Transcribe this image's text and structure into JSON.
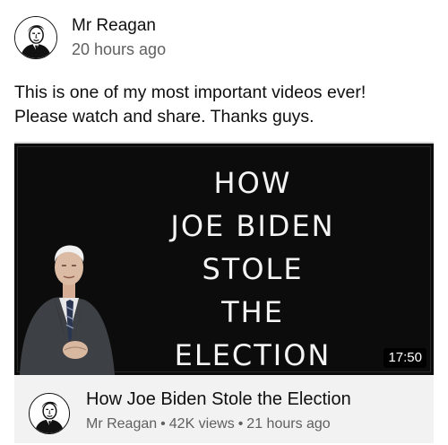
{
  "post": {
    "author": "Mr Reagan",
    "time": "20 hours ago",
    "text_lines": [
      "This is one of my most important videos ever!",
      "Please watch and share. Thanks guys."
    ]
  },
  "video": {
    "thumbnail_headline": [
      "HOW",
      "JOE BIDEN",
      "STOLE",
      "THE",
      "ELECTION"
    ],
    "duration": "17:50",
    "title": "How Joe Biden Stole the Election",
    "channel": "Mr Reagan",
    "views": "42K views",
    "age": "21 hours ago",
    "separator": "•"
  }
}
